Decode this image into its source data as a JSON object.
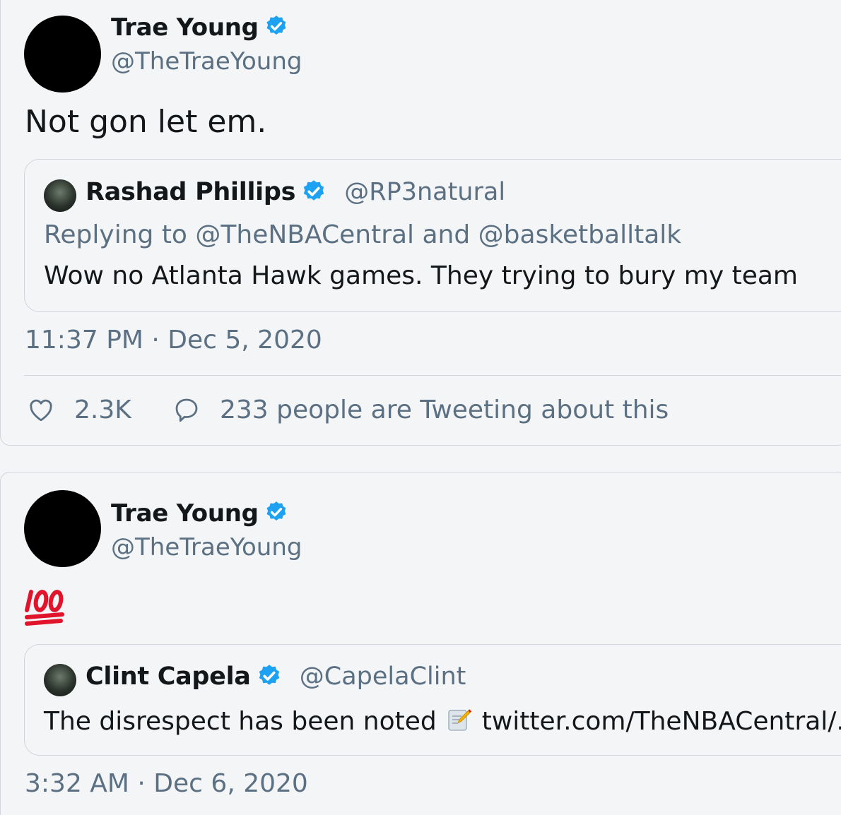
{
  "tweet1": {
    "author_name": "Trae Young",
    "author_handle": "@TheTraeYoung",
    "text": "Not gon let em.",
    "quote": {
      "author_name": "Rashad Phillips",
      "author_handle": "@RP3natural",
      "replying_to": "Replying to @TheNBACentral and @basketballtalk",
      "text": "Wow no Atlanta Hawk games. They trying to bury my team"
    },
    "timestamp": "11:37 PM · Dec 5, 2020",
    "likes": "2.3K",
    "tweeting_about": "233 people are Tweeting about this"
  },
  "tweet2": {
    "author_name": "Trae Young",
    "author_handle": "@TheTraeYoung",
    "emoji_icon": "hundred-points-emoji",
    "quote": {
      "author_name": "Clint Capela",
      "author_handle": "@CapelaClint",
      "text_before": "The disrespect has been noted",
      "memo_icon": "memo-emoji",
      "link": "twitter.com/TheNBACentral/..."
    },
    "timestamp": "3:32 AM · Dec 6, 2020"
  },
  "colors": {
    "background": "#f4f5f7",
    "primary_text": "#14171a",
    "secondary_text": "#5b7083",
    "verified_blue": "#1da1f2",
    "border": "#cfd5db",
    "emoji_red": "#e0142b"
  }
}
